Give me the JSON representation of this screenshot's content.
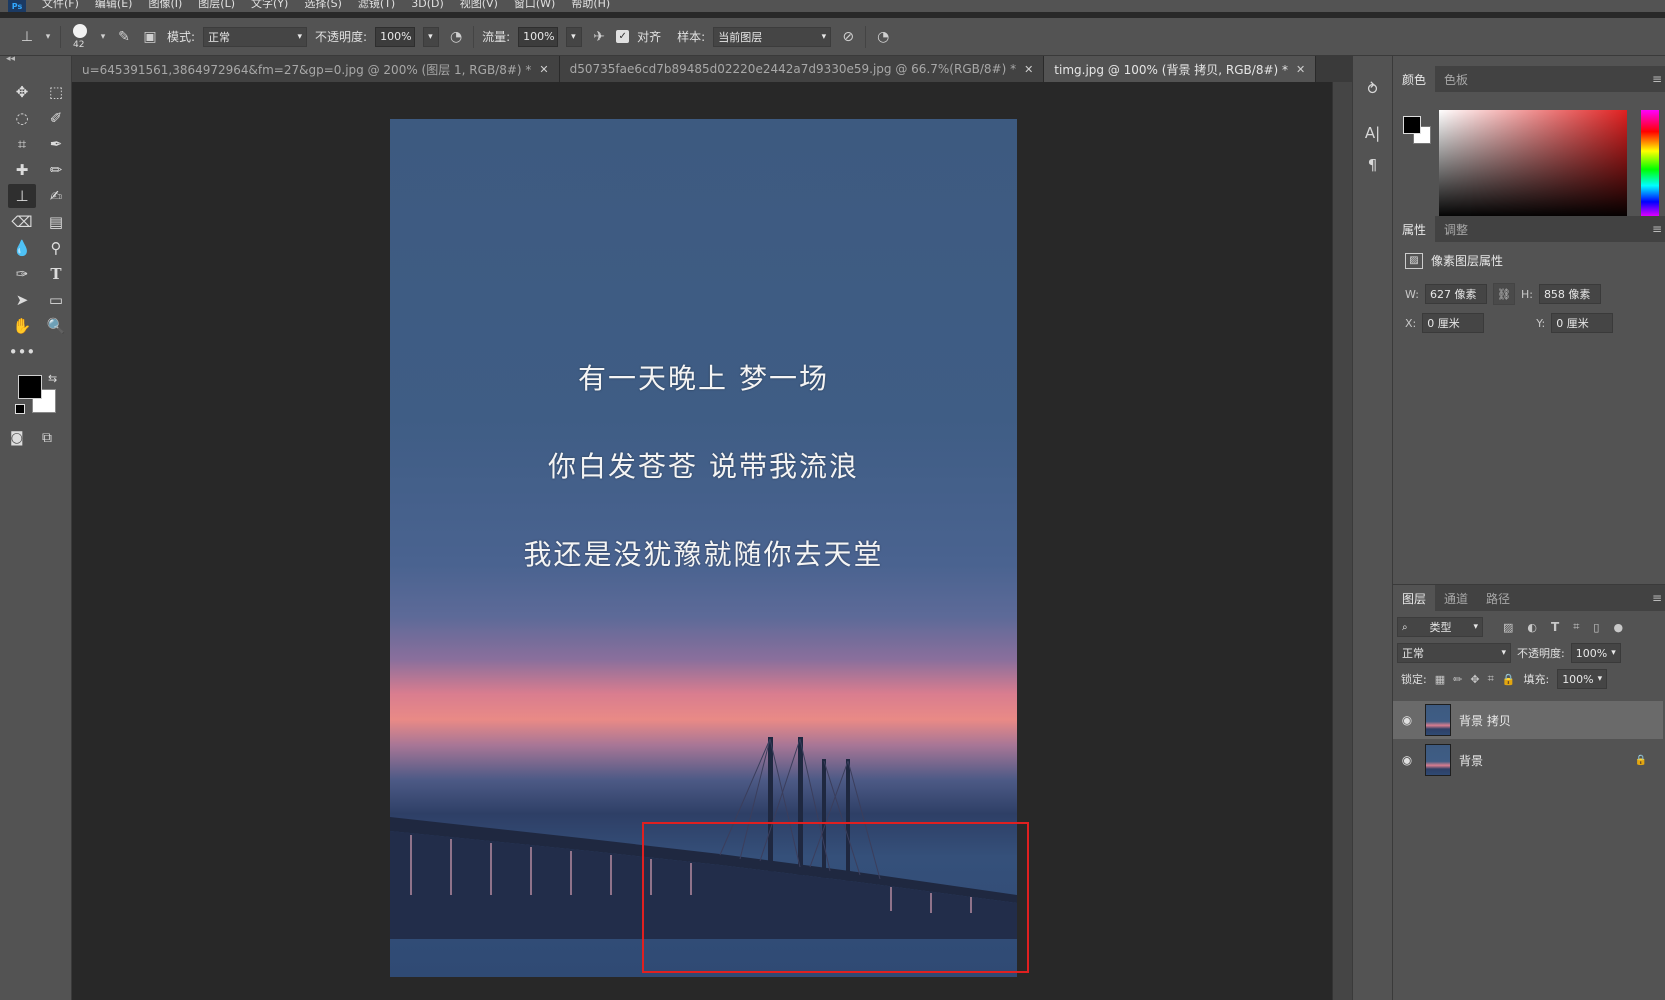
{
  "menubar": {
    "logo": "Ps",
    "items": [
      "文件(F)",
      "编辑(E)",
      "图像(I)",
      "图层(L)",
      "文字(Y)",
      "选择(S)",
      "滤镜(T)",
      "3D(D)",
      "视图(V)",
      "窗口(W)",
      "帮助(H)"
    ]
  },
  "options": {
    "brush_size": "42",
    "mode_label": "模式:",
    "mode_value": "正常",
    "opacity_label": "不透明度:",
    "opacity_value": "100%",
    "flow_label": "流量:",
    "flow_value": "100%",
    "aligned_label": "对齐",
    "sample_label": "样本:",
    "sample_value": "当前图层"
  },
  "tabs": [
    {
      "label": "u=645391561,3864972964&fm=27&gp=0.jpg @ 200% (图层 1, RGB/8#) *"
    },
    {
      "label": "d50735fae6cd7b89485d02220e2442a7d9330e59.jpg @ 66.7%(RGB/8#) *"
    },
    {
      "label": "timg.jpg @ 100% (背景 拷贝, RGB/8#) *"
    }
  ],
  "canvas": {
    "poem": [
      "有一天晚上  梦一场",
      "你白发苍苍 说带我流浪",
      "我还是没犹豫就随你去天堂"
    ],
    "selection_color": "#e02020"
  },
  "panels": {
    "color_tabs": [
      "颜色",
      "色板"
    ],
    "props_tabs": [
      "属性",
      "调整"
    ],
    "props_title": "像素图层属性",
    "w_label": "W:",
    "w_value": "627 像素",
    "h_label": "H:",
    "h_value": "858 像素",
    "x_label": "X:",
    "x_value": "0 厘米",
    "y_label": "Y:",
    "y_value": "0 厘米",
    "layers_tabs": [
      "图层",
      "通道",
      "路径"
    ],
    "filter_value": "类型",
    "blend_value": "正常",
    "opacity_label": "不透明度:",
    "opacity_value": "100%",
    "lock_label": "锁定:",
    "fill_label": "填充:",
    "fill_value": "100%",
    "layers": [
      {
        "name": "背景 拷贝",
        "active": true,
        "locked": false
      },
      {
        "name": "背景",
        "active": false,
        "locked": true
      }
    ]
  }
}
